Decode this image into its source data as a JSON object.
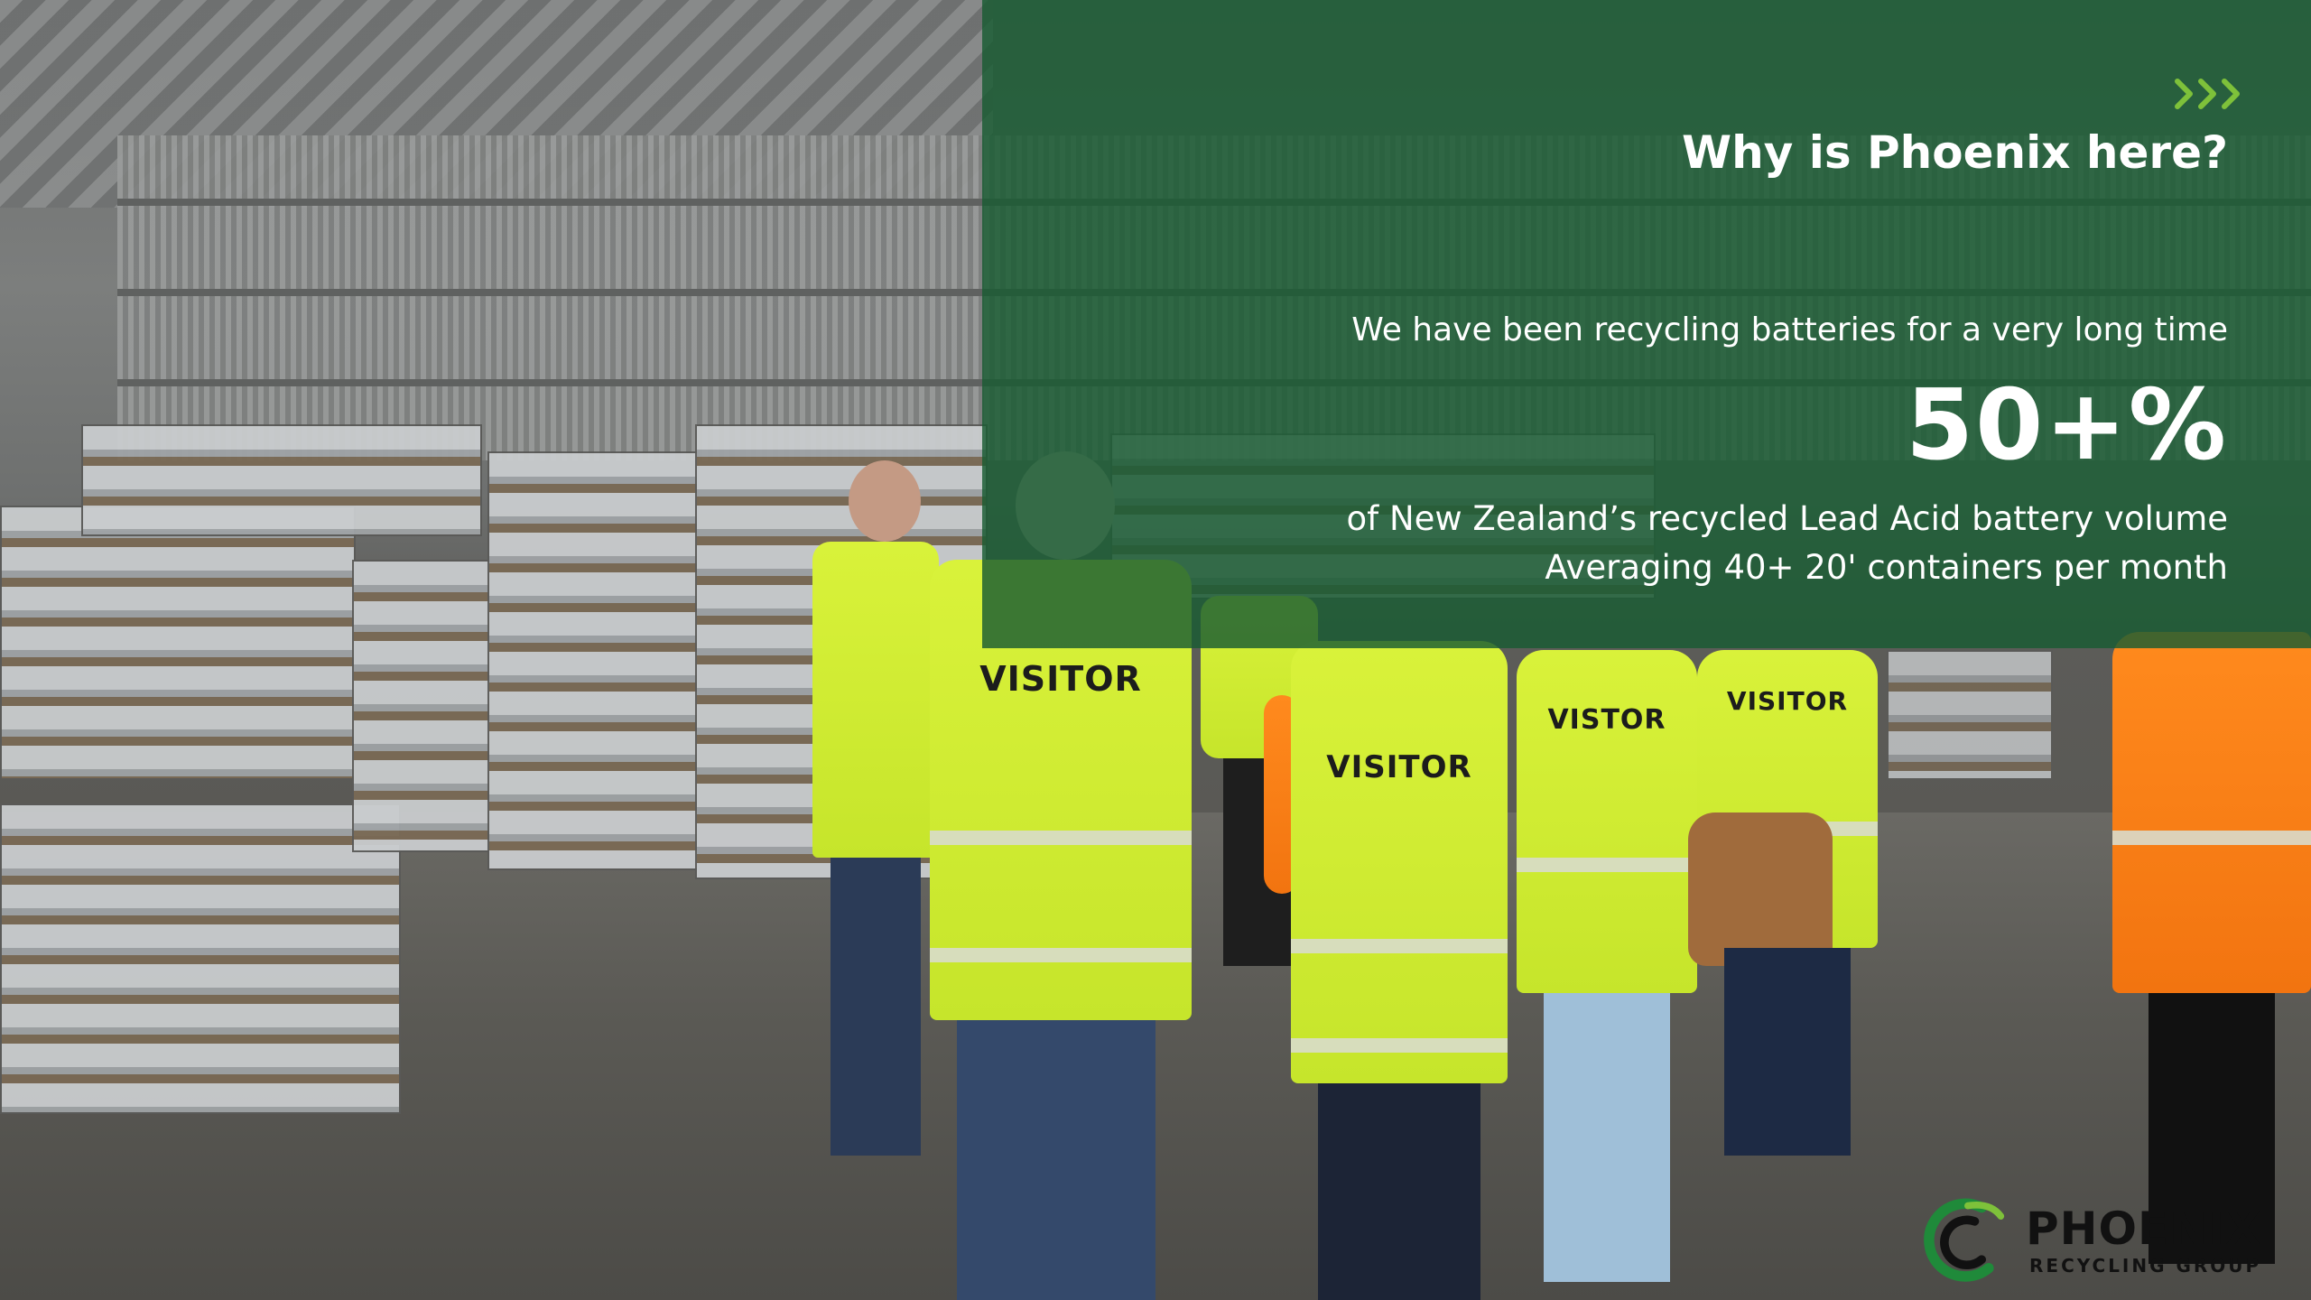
{
  "slide": {
    "title": "Why is Phoenix here?",
    "intro": "We have been recycling batteries for a very long time",
    "big_stat": "50+%",
    "stat_lines": [
      "of New Zealand’s recycled Lead Acid battery volume",
      "Averaging 40+  20' containers per month"
    ],
    "panel_color": "#195c32",
    "accent_color": "#7ec13a"
  },
  "photo": {
    "vest_labels": [
      "VISITOR",
      "VISITOR",
      "VISTOR",
      "VISITOR"
    ]
  },
  "logo": {
    "name": "PHOENIX",
    "subtitle": "RECYCLING GROUP",
    "icon": "phoenix-swoosh-icon"
  }
}
